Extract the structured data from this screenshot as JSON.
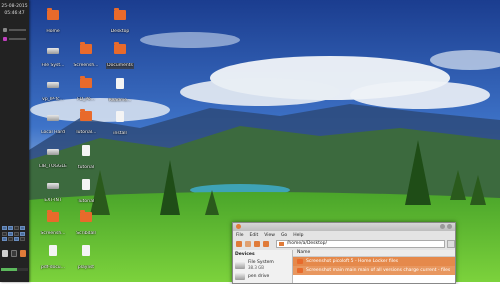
{
  "panel": {
    "clock_date": "25-08-2015",
    "clock_time": "05:46:47",
    "workspace_count": 16,
    "active_workspace": 1,
    "progress": 0.6
  },
  "desktop_icons": [
    {
      "label": "Home",
      "type": "folder"
    },
    {
      "label": "Desktop",
      "type": "folder"
    },
    {
      "label": "File Syst...",
      "type": "drive"
    },
    {
      "label": "Screensh...",
      "type": "folder"
    },
    {
      "label": "Documents",
      "type": "folder"
    },
    {
      "label": "vp_IP-fc...",
      "type": "drive"
    },
    {
      "label": "FD_Po...",
      "type": "folder"
    },
    {
      "label": "Readme...",
      "type": "doc"
    },
    {
      "label": "Local Hard",
      "type": "drive"
    },
    {
      "label": "Tutorial...",
      "type": "folder"
    },
    {
      "label": "install",
      "type": "doc"
    },
    {
      "label": "LIB_TOGGLE",
      "type": "drive"
    },
    {
      "label": "tutorial",
      "type": "doc"
    },
    {
      "label": "EXT-INT",
      "type": "drive"
    },
    {
      "label": "Tutorial",
      "type": "doc"
    },
    {
      "label": "Screensh...",
      "type": "folder"
    },
    {
      "label": "Scribdall",
      "type": "folder"
    },
    {
      "label": "pdf-docu...",
      "type": "doc"
    },
    {
      "label": "playlist",
      "type": "doc"
    }
  ],
  "file_manager": {
    "menu": [
      "File",
      "Edit",
      "View",
      "Go",
      "Help"
    ],
    "address": "/home/a/Desktop/",
    "column_header": "Name",
    "sidebar_header": "Devices",
    "sidebar_items": [
      {
        "label": "File System",
        "sub": "38.3 GB"
      },
      {
        "label": "pen drive",
        "sub": ""
      }
    ],
    "rows": [
      "Screenshot picoloft 5 - Home Locker files",
      "Screenshot main main main of all versions charge current - files"
    ]
  },
  "colors": {
    "accent": "#e86a2b",
    "panel_bg": "#222222",
    "selection": "#e5894b"
  }
}
